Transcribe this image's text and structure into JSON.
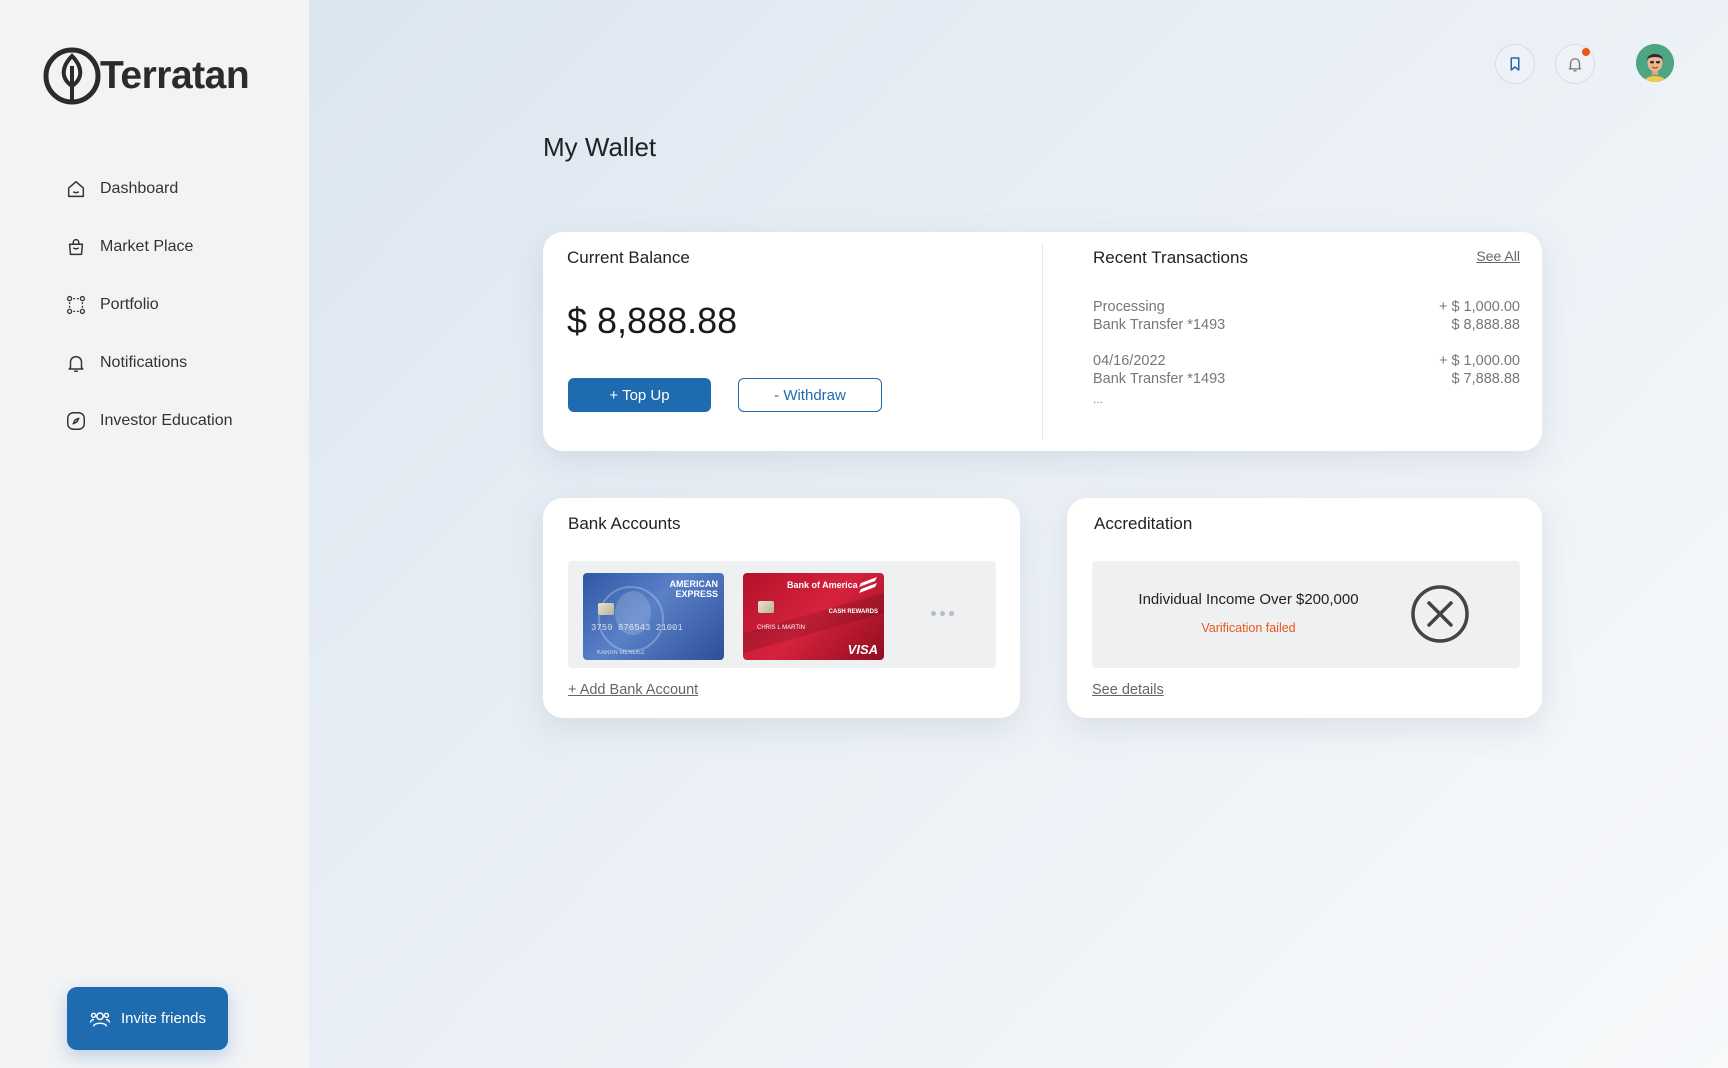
{
  "brand": {
    "name": "Terratan"
  },
  "sidebar": {
    "items": [
      {
        "label": "Dashboard",
        "icon": "home-icon"
      },
      {
        "label": "Market Place",
        "icon": "bag-icon"
      },
      {
        "label": "Portfolio",
        "icon": "portfolio-icon"
      },
      {
        "label": "Notifications",
        "icon": "bell-icon"
      },
      {
        "label": "Investor Education",
        "icon": "compass-icon"
      }
    ],
    "invite_label": "Invite friends"
  },
  "header": {
    "notification_dot_color": "#e8581c"
  },
  "page": {
    "title": "My Wallet"
  },
  "balance_card": {
    "title": "Current Balance",
    "amount": "$ 8,888.88",
    "topup_label": "+ Top Up",
    "withdraw_label": "- Withdraw"
  },
  "transactions": {
    "title": "Recent Transactions",
    "see_all": "See All",
    "items": [
      {
        "status": "Processing",
        "amount": "+ $ 1,000.00",
        "desc": "Bank Transfer *1493",
        "balance": "$ 8,888.88"
      },
      {
        "status": "04/16/2022",
        "amount": "+ $ 1,000.00",
        "desc": "Bank Transfer *1493",
        "balance": "$ 7,888.88"
      }
    ],
    "more": "..."
  },
  "bank_accounts": {
    "title": "Bank Accounts",
    "add_label": "+ Add Bank Account",
    "cards": [
      {
        "issuer_line1": "AMERICAN",
        "issuer_line2": "EXPRESS",
        "number": "3759 876543 21001",
        "holder": "KARAN MENDEZ"
      },
      {
        "issuer": "Bank of America",
        "program": "CASH REWARDS",
        "holder": "CHRIS L MARTIN",
        "network": "VISA"
      }
    ]
  },
  "accreditation": {
    "title": "Accreditation",
    "criterion": "Individual Income Over $200,000",
    "status": "Varification failed",
    "details_label": "See details"
  },
  "colors": {
    "primary": "#1f6bb0",
    "error": "#e8581c"
  }
}
